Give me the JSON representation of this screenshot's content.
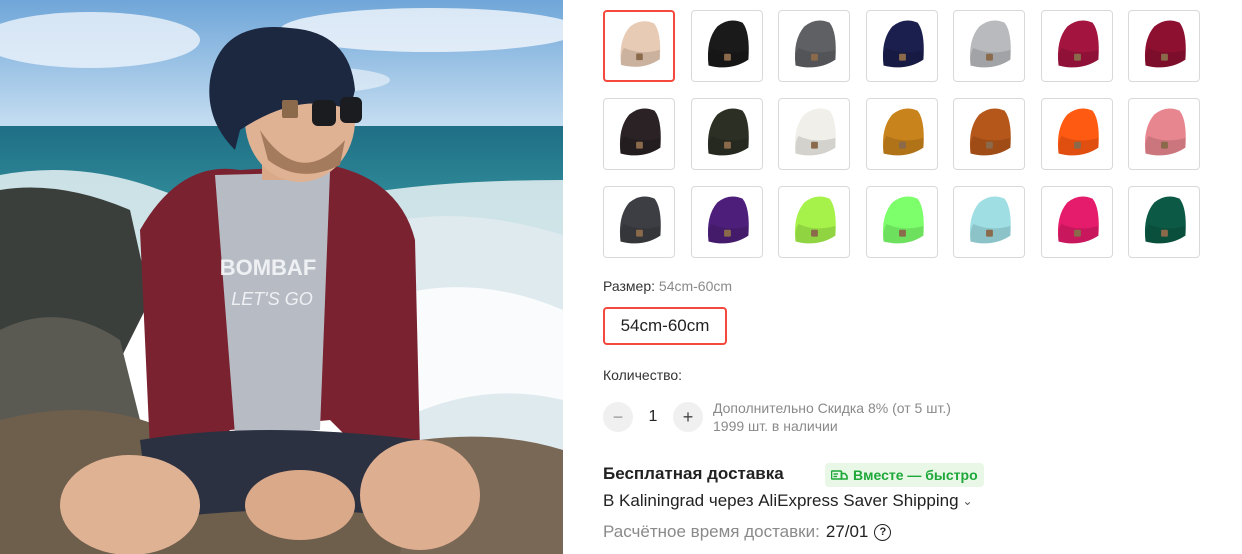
{
  "product": {
    "colors": [
      {
        "name": "beige",
        "hex": "#e8cbb5",
        "selected": true
      },
      {
        "name": "black",
        "hex": "#1a1a1a"
      },
      {
        "name": "dark-gray",
        "hex": "#5f6064"
      },
      {
        "name": "navy",
        "hex": "#1b1f4d"
      },
      {
        "name": "light-gray",
        "hex": "#b9babd"
      },
      {
        "name": "wine",
        "hex": "#a3143f"
      },
      {
        "name": "burgundy",
        "hex": "#8e1031"
      },
      {
        "name": "dark-brown",
        "hex": "#2a2224"
      },
      {
        "name": "army-green",
        "hex": "#2c2f24"
      },
      {
        "name": "white",
        "hex": "#f1efe9"
      },
      {
        "name": "mustard",
        "hex": "#c9831c"
      },
      {
        "name": "caramel",
        "hex": "#b5571b"
      },
      {
        "name": "orange",
        "hex": "#ff5a12"
      },
      {
        "name": "pink",
        "hex": "#e8868f"
      },
      {
        "name": "charcoal",
        "hex": "#3c3e43"
      },
      {
        "name": "purple",
        "hex": "#4e1f7a"
      },
      {
        "name": "lime",
        "hex": "#a6f24a"
      },
      {
        "name": "neon-green",
        "hex": "#7dff6b"
      },
      {
        "name": "sky-blue",
        "hex": "#9fdfe4"
      },
      {
        "name": "rose",
        "hex": "#e51b6b"
      },
      {
        "name": "emerald",
        "hex": "#0c5a45"
      }
    ],
    "size": {
      "label": "Размер:",
      "value": "54cm-60cm",
      "options": [
        "54cm-60cm"
      ]
    },
    "quantity": {
      "label": "Количество:",
      "value": "1",
      "minus": "−",
      "plus": "+",
      "discount": "Дополнительно Скидка 8% (от 5 шт.)",
      "stock": "1999 шт. в наличии"
    },
    "shipping": {
      "title": "Бесплатная доставка",
      "badge": "Вместе — быстро",
      "route": "В Kaliningrad через AliExpress Saver Shipping",
      "eta_label": "Расчётное время доставки:",
      "eta_date": "27/01",
      "help": "?"
    }
  },
  "photo": {
    "shirt_text_1": "BOMBAF",
    "shirt_text_2": "LET'S GO"
  },
  "colors": {
    "accent": "#f4493c",
    "muted": "#8a8a8a",
    "badge_green": "#1fa83a",
    "badge_bg": "#e8f7e6"
  }
}
